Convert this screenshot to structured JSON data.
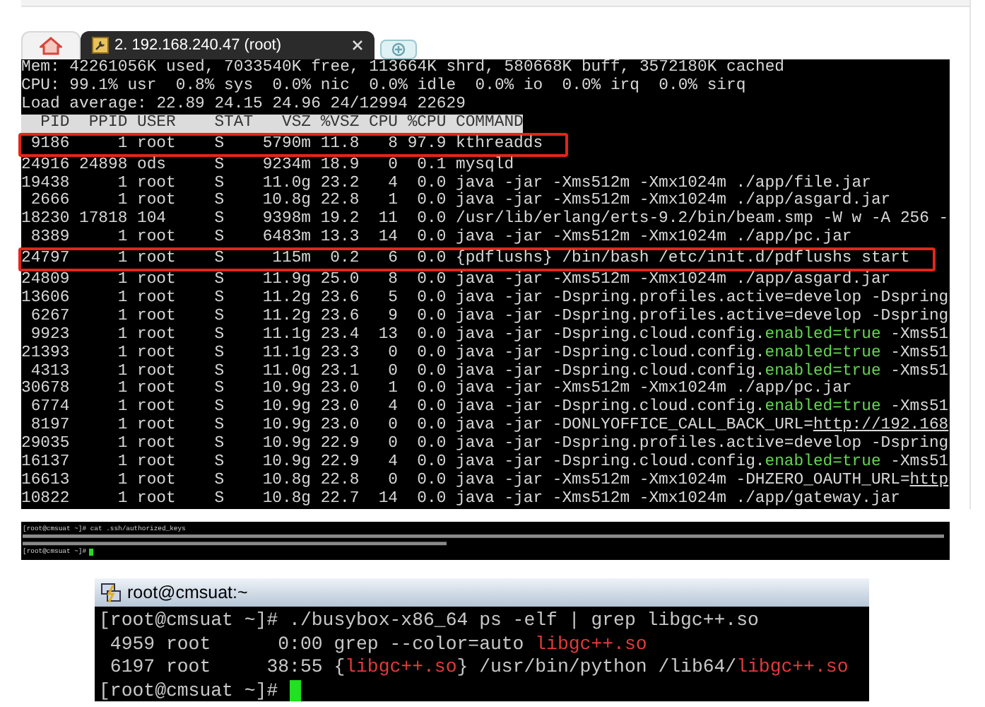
{
  "top_terminal": {
    "tab": {
      "title": "2. 192.168.240.47 (root)",
      "selected": true
    },
    "summary_lines": [
      "Mem: 42261056K used, 7033540K free, 113664K shrd, 580668K buff, 3572180K cached",
      "CPU: 99.1% usr  0.8% sys  0.0% nic  0.0% idle  0.0% io  0.0% irq  0.0% sirq",
      "Load average: 22.89 24.15 24.96 24/12994 22629"
    ],
    "columns": [
      "PID",
      "PPID",
      "USER",
      "STAT",
      "VSZ",
      "%VSZ",
      "CPU",
      "%CPU",
      "COMMAND"
    ],
    "rows": [
      {
        "pid": "9186",
        "ppid": "1",
        "user": "root",
        "stat": "S",
        "vsz": "5790m",
        "pvsz": "11.8",
        "cpu": "8",
        "pcpu": "97.9",
        "highlighted": true,
        "command": [
          {
            "text": "kthreadds",
            "kind": "plain"
          }
        ]
      },
      {
        "pid": "24916",
        "ppid": "24898",
        "user": "ods",
        "stat": "S",
        "vsz": "9234m",
        "pvsz": "18.9",
        "cpu": "0",
        "pcpu": "0.1",
        "highlighted": false,
        "command": [
          {
            "text": "mysqld",
            "kind": "plain"
          }
        ]
      },
      {
        "pid": "19438",
        "ppid": "1",
        "user": "root",
        "stat": "S",
        "vsz": "11.0g",
        "pvsz": "23.2",
        "cpu": "4",
        "pcpu": "0.0",
        "highlighted": false,
        "command": [
          {
            "text": "java -jar -Xms512m -Xmx1024m ./app/file.jar",
            "kind": "plain"
          }
        ]
      },
      {
        "pid": "2666",
        "ppid": "1",
        "user": "root",
        "stat": "S",
        "vsz": "10.8g",
        "pvsz": "22.8",
        "cpu": "1",
        "pcpu": "0.0",
        "highlighted": false,
        "command": [
          {
            "text": "java -jar -Xms512m -Xmx1024m ./app/asgard.jar",
            "kind": "plain"
          }
        ]
      },
      {
        "pid": "18230",
        "ppid": "17818",
        "user": "104",
        "stat": "S",
        "vsz": "9398m",
        "pvsz": "19.2",
        "cpu": "11",
        "pcpu": "0.0",
        "highlighted": false,
        "command": [
          {
            "text": "/usr/lib/erlang/erts-9.2/bin/beam.smp -W w -A 256 -",
            "kind": "plain"
          }
        ]
      },
      {
        "pid": "8389",
        "ppid": "1",
        "user": "root",
        "stat": "S",
        "vsz": "6483m",
        "pvsz": "13.3",
        "cpu": "14",
        "pcpu": "0.0",
        "highlighted": false,
        "command": [
          {
            "text": "java -jar -Xms512m -Xmx1024m ./app/pc.jar",
            "kind": "plain"
          }
        ]
      },
      {
        "pid": "24797",
        "ppid": "1",
        "user": "root",
        "stat": "S",
        "vsz": "115m",
        "pvsz": "0.2",
        "cpu": "6",
        "pcpu": "0.0",
        "highlighted": true,
        "command": [
          {
            "text": "{pdflushs} /bin/bash /etc/init.d/pdflushs start",
            "kind": "plain"
          }
        ]
      },
      {
        "pid": "24809",
        "ppid": "1",
        "user": "root",
        "stat": "S",
        "vsz": "11.9g",
        "pvsz": "25.0",
        "cpu": "8",
        "pcpu": "0.0",
        "highlighted": false,
        "command": [
          {
            "text": "java -jar -Xms512m -Xmx1024m ./app/asgard.jar",
            "kind": "plain"
          }
        ]
      },
      {
        "pid": "13606",
        "ppid": "1",
        "user": "root",
        "stat": "S",
        "vsz": "11.2g",
        "pvsz": "23.6",
        "cpu": "5",
        "pcpu": "0.0",
        "highlighted": false,
        "command": [
          {
            "text": "java -jar -Dspring.profiles.active=develop -Dspring",
            "kind": "plain"
          }
        ]
      },
      {
        "pid": "6267",
        "ppid": "1",
        "user": "root",
        "stat": "S",
        "vsz": "11.2g",
        "pvsz": "23.6",
        "cpu": "9",
        "pcpu": "0.0",
        "highlighted": false,
        "command": [
          {
            "text": "java -jar -Dspring.profiles.active=develop -Dspring",
            "kind": "plain"
          }
        ]
      },
      {
        "pid": "9923",
        "ppid": "1",
        "user": "root",
        "stat": "S",
        "vsz": "11.1g",
        "pvsz": "23.4",
        "cpu": "13",
        "pcpu": "0.0",
        "highlighted": false,
        "command": [
          {
            "text": "java -jar -Dspring.cloud.config.",
            "kind": "plain"
          },
          {
            "text": "enabled=true",
            "kind": "green"
          },
          {
            "text": " -Xms51",
            "kind": "plain"
          }
        ]
      },
      {
        "pid": "21393",
        "ppid": "1",
        "user": "root",
        "stat": "S",
        "vsz": "11.1g",
        "pvsz": "23.3",
        "cpu": "0",
        "pcpu": "0.0",
        "highlighted": false,
        "command": [
          {
            "text": "java -jar -Dspring.cloud.config.",
            "kind": "plain"
          },
          {
            "text": "enabled=true",
            "kind": "green"
          },
          {
            "text": " -Xms51",
            "kind": "plain"
          }
        ]
      },
      {
        "pid": "4313",
        "ppid": "1",
        "user": "root",
        "stat": "S",
        "vsz": "11.0g",
        "pvsz": "23.1",
        "cpu": "0",
        "pcpu": "0.0",
        "highlighted": false,
        "command": [
          {
            "text": "java -jar -Dspring.cloud.config.",
            "kind": "plain"
          },
          {
            "text": "enabled=true",
            "kind": "green"
          },
          {
            "text": " -Xms51",
            "kind": "plain"
          }
        ]
      },
      {
        "pid": "30678",
        "ppid": "1",
        "user": "root",
        "stat": "S",
        "vsz": "10.9g",
        "pvsz": "23.0",
        "cpu": "1",
        "pcpu": "0.0",
        "highlighted": false,
        "command": [
          {
            "text": "java -jar -Xms512m -Xmx1024m ./app/pc.jar",
            "kind": "plain"
          }
        ]
      },
      {
        "pid": "6774",
        "ppid": "1",
        "user": "root",
        "stat": "S",
        "vsz": "10.9g",
        "pvsz": "23.0",
        "cpu": "4",
        "pcpu": "0.0",
        "highlighted": false,
        "command": [
          {
            "text": "java -jar -Dspring.cloud.config.",
            "kind": "plain"
          },
          {
            "text": "enabled=true",
            "kind": "green"
          },
          {
            "text": " -Xms51",
            "kind": "plain"
          }
        ]
      },
      {
        "pid": "8197",
        "ppid": "1",
        "user": "root",
        "stat": "S",
        "vsz": "10.9g",
        "pvsz": "23.0",
        "cpu": "0",
        "pcpu": "0.0",
        "highlighted": false,
        "command": [
          {
            "text": "java -jar -DONLYOFFICE_CALL_BACK_URL=",
            "kind": "plain"
          },
          {
            "text": "http://192.168",
            "kind": "link"
          }
        ]
      },
      {
        "pid": "29035",
        "ppid": "1",
        "user": "root",
        "stat": "S",
        "vsz": "10.9g",
        "pvsz": "22.9",
        "cpu": "0",
        "pcpu": "0.0",
        "highlighted": false,
        "command": [
          {
            "text": "java -jar -Dspring.profiles.active=develop -Dspring",
            "kind": "plain"
          }
        ]
      },
      {
        "pid": "16137",
        "ppid": "1",
        "user": "root",
        "stat": "S",
        "vsz": "10.9g",
        "pvsz": "22.9",
        "cpu": "4",
        "pcpu": "0.0",
        "highlighted": false,
        "command": [
          {
            "text": "java -jar -Dspring.cloud.config.",
            "kind": "plain"
          },
          {
            "text": "enabled=true",
            "kind": "green"
          },
          {
            "text": " -Xms51",
            "kind": "plain"
          }
        ]
      },
      {
        "pid": "16613",
        "ppid": "1",
        "user": "root",
        "stat": "S",
        "vsz": "10.8g",
        "pvsz": "22.8",
        "cpu": "0",
        "pcpu": "0.0",
        "highlighted": false,
        "command": [
          {
            "text": "java -jar -Xms512m -Xmx1024m -DHZERO_OAUTH_URL=",
            "kind": "plain"
          },
          {
            "text": "http",
            "kind": "link"
          }
        ]
      },
      {
        "pid": "10822",
        "ppid": "1",
        "user": "root",
        "stat": "S",
        "vsz": "10.8g",
        "pvsz": "22.7",
        "cpu": "14",
        "pcpu": "0.0",
        "highlighted": false,
        "command": [
          {
            "text": "java -jar -Xms512m -Xmx1024m ./app/gateway.jar",
            "kind": "plain"
          }
        ]
      }
    ]
  },
  "keys_terminal": {
    "command_line": "[root@cmsuat ~]# cat .ssh/authorized_keys",
    "prompt": "[root@cmsuat ~]#",
    "cursor": true
  },
  "putty_window": {
    "title": "root@cmsuat:~",
    "lines": [
      {
        "cursor": false,
        "segments": [
          {
            "text": "[root@cmsuat ~]# ./busybox-x86_64 ps -elf | grep libgc++.so",
            "kind": "plain"
          }
        ]
      },
      {
        "cursor": false,
        "segments": [
          {
            "text": " 4959 root      0:00 grep --color=auto ",
            "kind": "plain"
          },
          {
            "text": "libgc++.so",
            "kind": "red"
          }
        ]
      },
      {
        "cursor": false,
        "segments": [
          {
            "text": " 6197 root     38:55 {",
            "kind": "plain"
          },
          {
            "text": "libgc++.so",
            "kind": "red"
          },
          {
            "text": "} /usr/bin/python /lib64/",
            "kind": "plain"
          },
          {
            "text": "libgc++.so",
            "kind": "red"
          }
        ]
      },
      {
        "cursor": true,
        "segments": [
          {
            "text": "[root@cmsuat ~]# ",
            "kind": "plain"
          }
        ]
      }
    ]
  }
}
